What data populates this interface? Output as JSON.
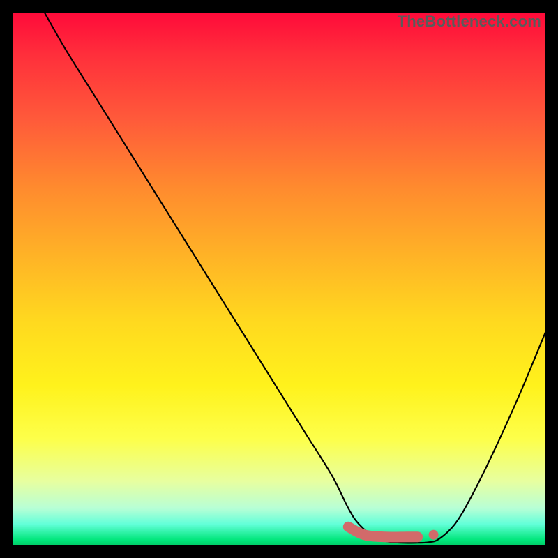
{
  "watermark": "TheBottleneck.com",
  "chart_data": {
    "type": "line",
    "title": "",
    "xlabel": "",
    "ylabel": "",
    "xlim": [
      0,
      100
    ],
    "ylim": [
      0,
      100
    ],
    "grid": false,
    "legend": false,
    "series": [
      {
        "name": "bottleneck-curve",
        "x": [
          6,
          10,
          15,
          20,
          25,
          30,
          35,
          40,
          45,
          50,
          55,
          60,
          63,
          65,
          68,
          70,
          73,
          76,
          78,
          80,
          83,
          86,
          90,
          95,
          100
        ],
        "y": [
          100,
          93,
          85,
          77,
          69,
          61,
          53,
          45,
          37,
          29,
          21,
          13,
          7,
          4,
          1.5,
          0.8,
          0.5,
          0.5,
          0.6,
          1.2,
          4,
          9,
          17,
          28,
          40
        ]
      }
    ],
    "marker": {
      "name": "optimal-range",
      "points": [
        {
          "x": 63,
          "y": 3.5
        },
        {
          "x": 66,
          "y": 2.0
        },
        {
          "x": 70,
          "y": 1.6
        },
        {
          "x": 74,
          "y": 1.6
        },
        {
          "x": 76,
          "y": 1.6
        }
      ],
      "dot": {
        "x": 79,
        "y": 2.0
      }
    }
  }
}
